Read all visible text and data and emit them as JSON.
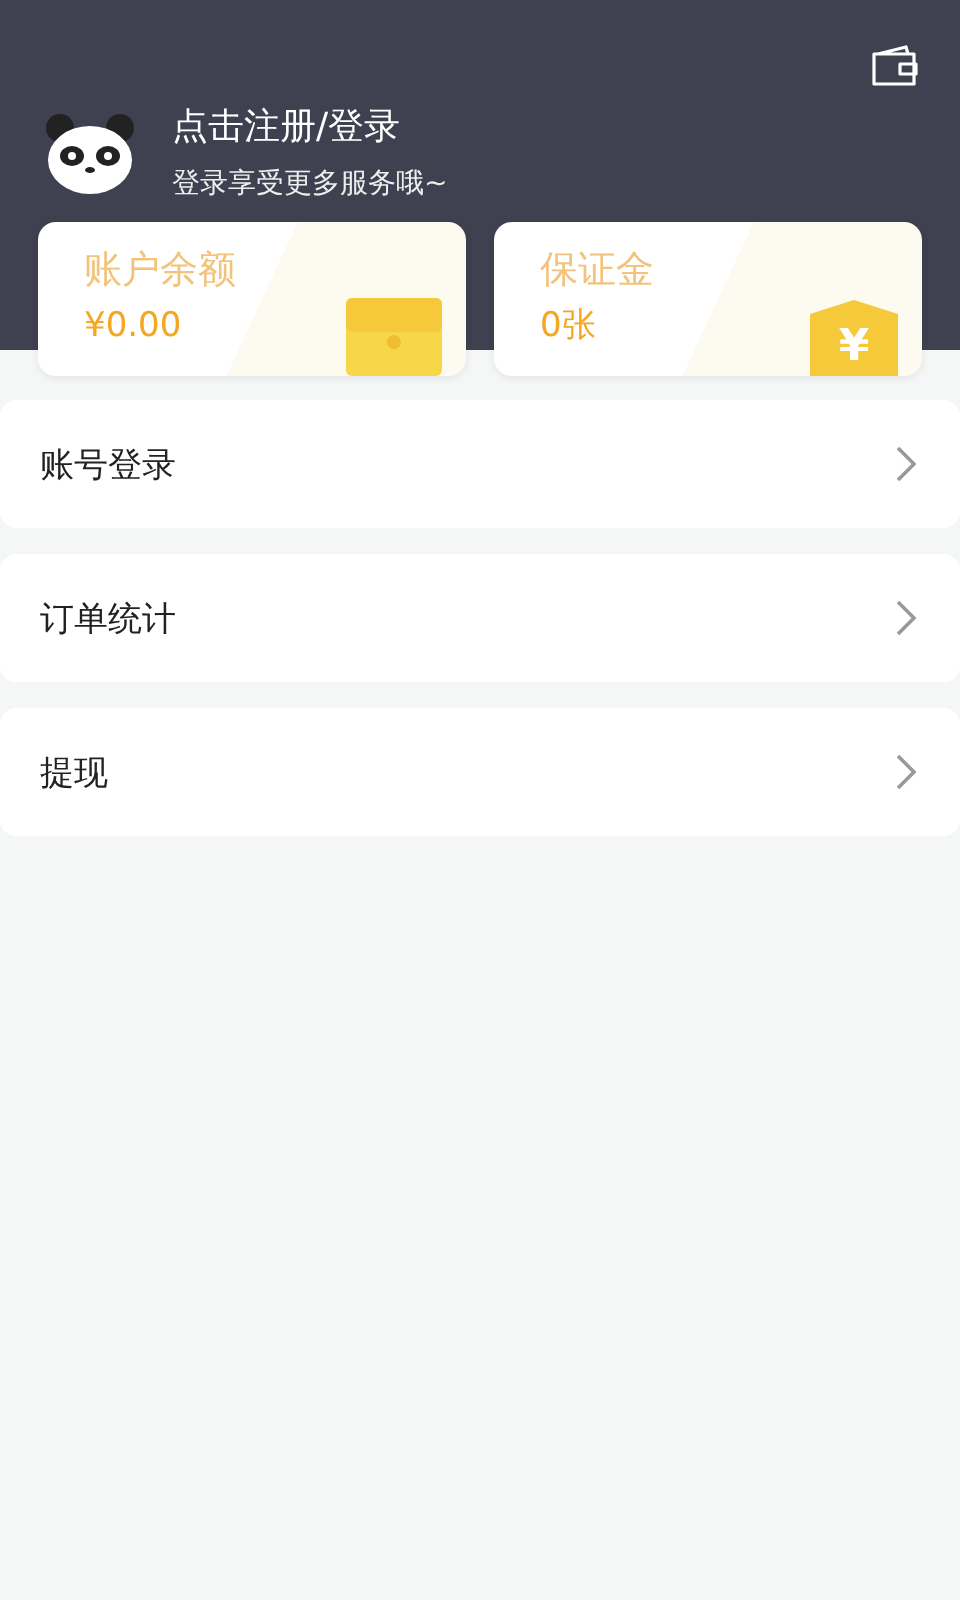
{
  "profile": {
    "title": "点击注册/登录",
    "subtitle": "登录享受更多服务哦~"
  },
  "cards": [
    {
      "kind": "wallet",
      "label": "账户余额",
      "value": "¥0.00"
    },
    {
      "kind": "shield",
      "label": "保证金",
      "value": "0张",
      "icon_text": "¥"
    }
  ],
  "menu": [
    {
      "label": "账号登录"
    },
    {
      "label": "订单统计"
    },
    {
      "label": "提现"
    }
  ]
}
